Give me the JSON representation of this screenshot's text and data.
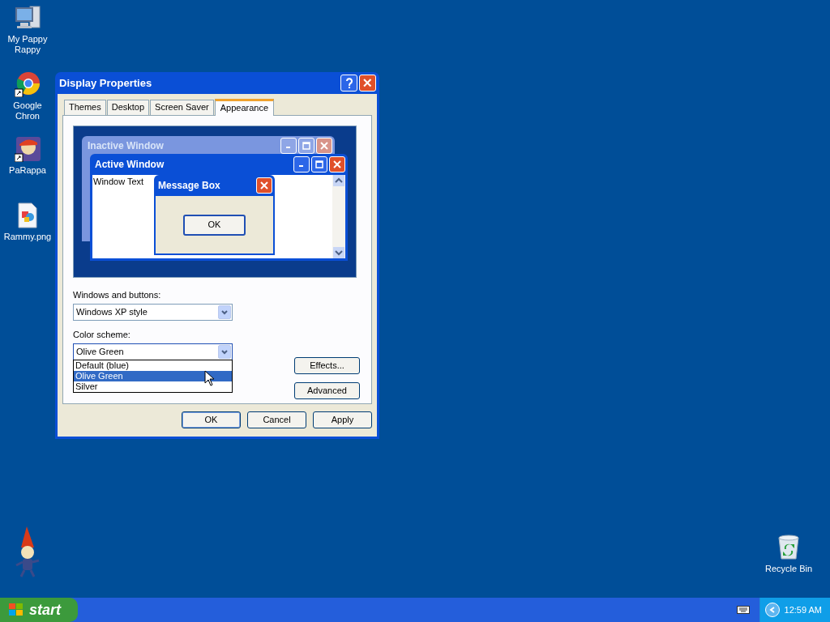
{
  "desktop_icons": [
    {
      "kind": "computer",
      "label": "My Pappy Rappy"
    },
    {
      "kind": "browser",
      "label": "Google Chron"
    },
    {
      "kind": "avatar",
      "label": "PaRappa"
    },
    {
      "kind": "image",
      "label": "Rammy.png"
    },
    {
      "kind": "recycle",
      "label": "Recycle Bin"
    }
  ],
  "dialog": {
    "title": "Display Properties",
    "tabs": [
      {
        "label": "Themes",
        "selected": false
      },
      {
        "label": "Desktop",
        "selected": false
      },
      {
        "label": "Screen Saver",
        "selected": false
      },
      {
        "label": "Appearance",
        "selected": true
      }
    ],
    "preview": {
      "inactive_title": "Inactive Window",
      "active_title": "Active Window",
      "window_text": "Window Text",
      "message_title": "Message Box",
      "message_button": "OK"
    },
    "windows_and_buttons": {
      "label": "Windows and buttons:",
      "value": "Windows XP style"
    },
    "color_scheme": {
      "label": "Color scheme:",
      "value": "Olive Green",
      "expanded": true,
      "options": [
        {
          "label": "Default (blue)",
          "selected": false
        },
        {
          "label": "Olive Green",
          "selected": true
        },
        {
          "label": "Silver",
          "selected": false
        }
      ]
    },
    "side_buttons": [
      "Effects...",
      "Advanced"
    ],
    "buttons": [
      "OK",
      "Cancel",
      "Apply"
    ]
  },
  "taskbar": {
    "start": "start",
    "clock": "12:59 AM"
  }
}
